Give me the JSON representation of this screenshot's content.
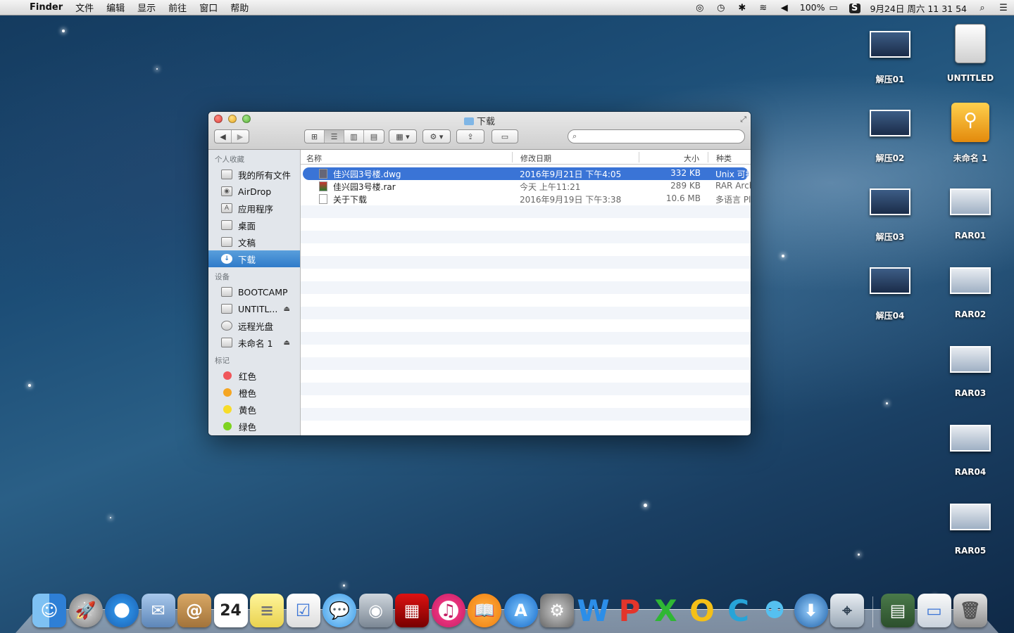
{
  "menubar": {
    "app_name": "Finder",
    "menus": [
      "文件",
      "编辑",
      "显示",
      "前往",
      "窗口",
      "帮助"
    ],
    "battery": "100%",
    "datetime": "9月24日 周六  11 31 54"
  },
  "window": {
    "title": "下载",
    "search_placeholder": "",
    "sidebar": {
      "favorites_header": "个人收藏",
      "favorites": [
        "我的所有文件",
        "AirDrop",
        "应用程序",
        "桌面",
        "文稿",
        "下载"
      ],
      "devices_header": "设备",
      "devices": [
        "BOOTCAMP",
        "UNTITL...",
        "远程光盘",
        "未命名 1"
      ],
      "tags_header": "标记",
      "tags": [
        {
          "label": "红色",
          "color": "#f0565a"
        },
        {
          "label": "橙色",
          "color": "#f5a623"
        },
        {
          "label": "黄色",
          "color": "#f7dc2a"
        },
        {
          "label": "绿色",
          "color": "#7ed321"
        }
      ]
    },
    "columns": {
      "name": "名称",
      "date": "修改日期",
      "size": "大小",
      "kind": "种类"
    },
    "files": [
      {
        "name": "佳兴园3号楼.dwg",
        "date": "2016年9月21日 下午4:05",
        "size": "332 KB",
        "kind": "Unix 可执"
      },
      {
        "name": "佳兴园3号楼.rar",
        "date": "今天 上午11:21",
        "size": "289 KB",
        "kind": "RAR Arch"
      },
      {
        "name": "关于下载",
        "date": "2016年9月19日 下午3:38",
        "size": "10.6 MB",
        "kind": "多语言 Pl"
      }
    ]
  },
  "desktop_icons": {
    "col1": [
      "解压01",
      "解压02",
      "解压03",
      "解压04"
    ],
    "col2": [
      "UNTITLED",
      "未命名 1",
      "RAR01",
      "RAR02",
      "RAR03",
      "RAR04",
      "RAR05"
    ]
  },
  "dock": {
    "calendar_day": "24",
    "apps": [
      "finder-icon",
      "launchpad-icon",
      "safari-icon",
      "mail-icon",
      "contacts-icon",
      "calendar-icon",
      "notes-icon",
      "reminders-icon",
      "messages-icon",
      "facetime-icon",
      "photo-booth-icon",
      "itunes-icon",
      "ibooks-icon",
      "app-store-icon",
      "system-preferences-icon",
      "word-icon",
      "powerpoint-icon",
      "excel-icon",
      "outlook-icon",
      "communicator-icon",
      "messenger-icon",
      "download-icon",
      "network-icon",
      "archive-icon",
      "preview-icon",
      "trash-icon"
    ]
  }
}
